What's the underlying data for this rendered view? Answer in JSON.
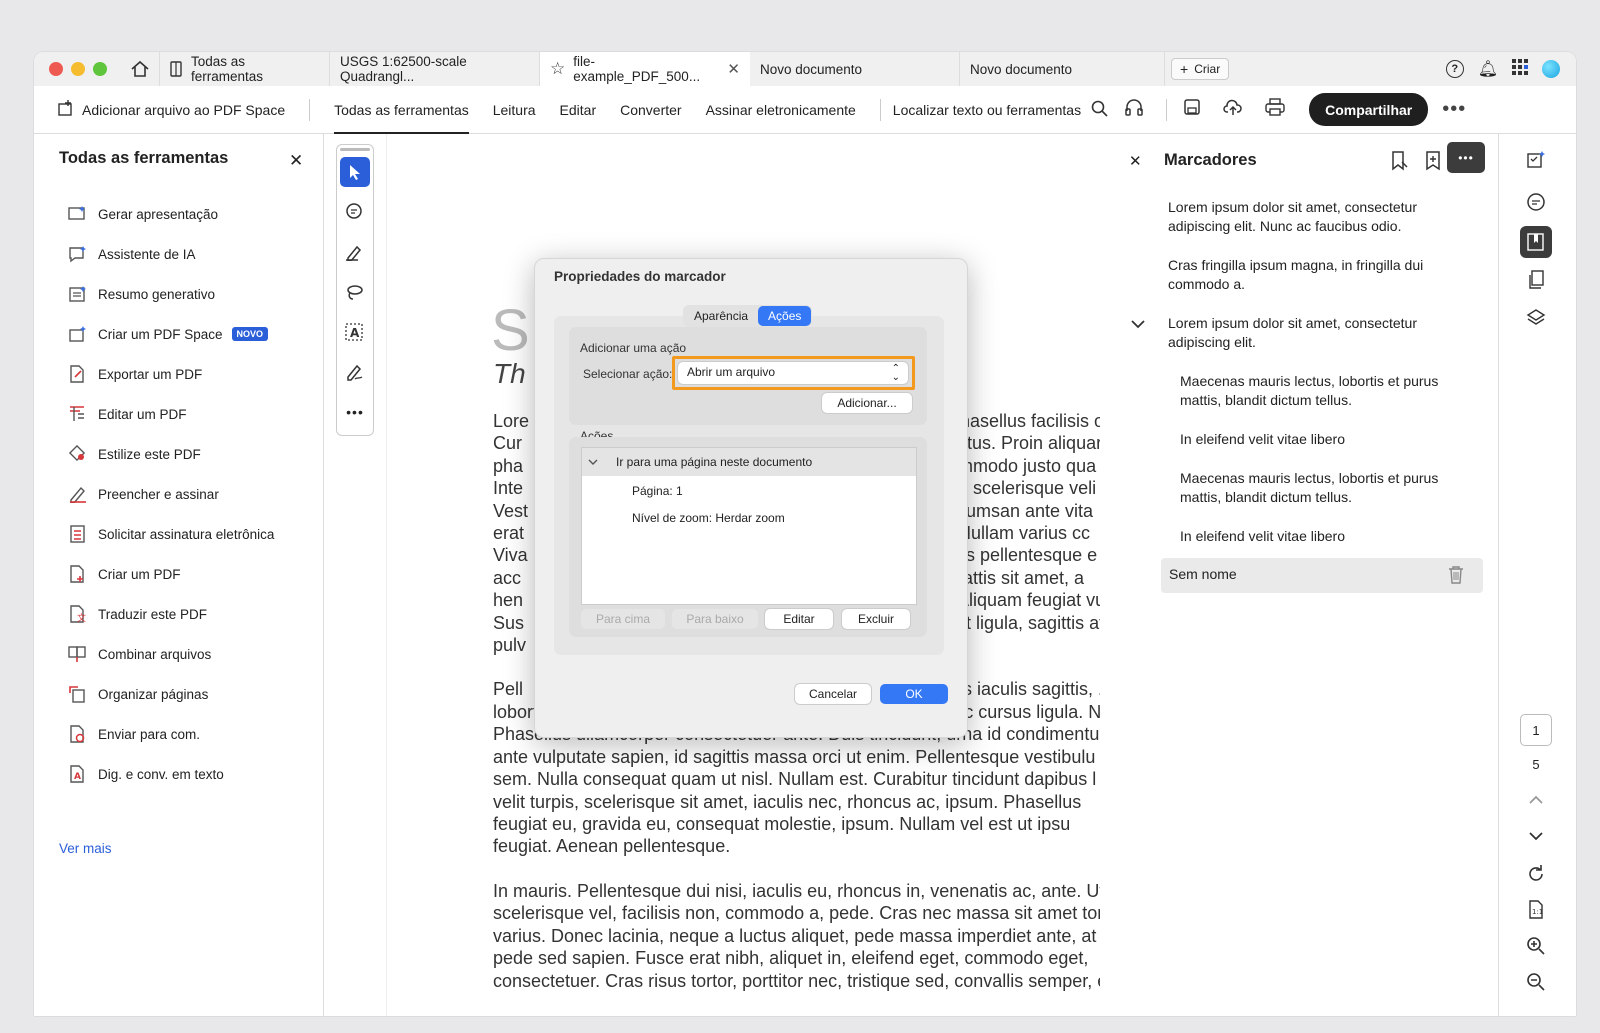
{
  "tabs": {
    "tools": "Todas as ferramentas",
    "usgs": "USGS 1:62500-scale Quadrangl...",
    "file": "file-example_PDF_500...",
    "novo1": "Novo documento",
    "novo2": "Novo documento",
    "criar": "Criar"
  },
  "toolbar": {
    "add_space": "Adicionar arquivo ao PDF Space",
    "all_tools": "Todas as ferramentas",
    "read": "Leitura",
    "edit": "Editar",
    "convert": "Converter",
    "sign": "Assinar eletronicamente",
    "find": "Localizar texto ou ferramentas",
    "share": "Compartilhar"
  },
  "left_panel": {
    "title": "Todas as ferramentas",
    "items": [
      "Gerar apresentação",
      "Assistente de IA",
      "Resumo generativo",
      "Criar um PDF Space",
      "Exportar um PDF",
      "Editar um PDF",
      "Estilize este PDF",
      "Preencher e assinar",
      "Solicitar assinatura eletrônica",
      "Criar um PDF",
      "Traduzir este PDF",
      "Combinar arquivos",
      "Organizar páginas",
      "Enviar para com.",
      "Dig. e conv. em texto"
    ],
    "badge": "NOVO",
    "see_more": "Ver mais"
  },
  "document": {
    "big_letter": "S",
    "subtitle": "Th",
    "p1_left": [
      "Lore",
      "Cur",
      "pha",
      "Inte",
      "Vest",
      "erat",
      "Viva",
      "acc",
      "hen",
      "Sus",
      "pulv"
    ],
    "p1_right": [
      "Phasellus facilisis o",
      "ectus. Proin aliquar",
      "ommodo justo qua",
      "an scelerisque veli",
      "ccumsan ante vita",
      ". Nullam varius cc",
      "llus pellentesque e",
      "mattis sit amet, a",
      ". Aliquam feugiat vu",
      "elit ligula, sagittis at",
      ""
    ],
    "p2_first_left": "Pell",
    "p2_first_right": "uis iaculis sagittis, .",
    "p2_rest": [
      "lobortis tortor, sed vestibulum dui metus venenatis est. Nunc cursus ligula. N",
      "Phasellus ullamcorper consectetuer ante. Duis tincidunt, urna id condimentum",
      "ante vulputate sapien, id sagittis massa orci ut enim. Pellentesque vestibulu",
      "sem. Nulla consequat quam ut nisl. Nullam est. Curabitur tincidunt dapibus l",
      "velit turpis, scelerisque sit amet, iaculis nec, rhoncus ac, ipsum. Phasellus",
      "feugiat eu, gravida eu, consequat molestie, ipsum. Nullam vel est ut ipsu",
      "feugiat. Aenean pellentesque."
    ],
    "p3": [
      "In mauris. Pellentesque dui nisi, iaculis eu, rhoncus in, venenatis ac, ante. Ut",
      "scelerisque vel, facilisis non, commodo a, pede. Cras nec massa sit amet tor",
      "varius. Donec lacinia, neque a luctus aliquet, pede massa imperdiet ante, at v",
      "pede sed sapien. Fusce erat nibh, aliquet in, eleifend eget, commodo eget,",
      "consectetuer. Cras risus tortor, porttitor nec, tristique sed, convallis semper, e"
    ]
  },
  "dialog": {
    "title": "Propriedades do marcador",
    "tab_appearance": "Aparência",
    "tab_actions": "Ações",
    "add_action": "Adicionar uma ação",
    "select_action_label": "Selecionar ação:",
    "select_action_value": "Abrir um arquivo",
    "add_button": "Adicionar...",
    "actions_label": "Ações",
    "action_item": "Ir para uma página neste documento",
    "page_detail": "Página: 1",
    "zoom_detail": "Nível de zoom: Herdar zoom",
    "btn_up": "Para cima",
    "btn_down": "Para baixo",
    "btn_edit": "Editar",
    "btn_delete": "Excluir",
    "cancel": "Cancelar",
    "ok": "OK"
  },
  "bookmarks": {
    "title": "Marcadores",
    "items": [
      [
        "Lorem ipsum dolor sit amet, consectetur",
        "adipiscing elit. Nunc ac faucibus odio."
      ],
      [
        "Cras fringilla ipsum magna, in fringilla dui",
        "commodo a."
      ],
      [
        "Lorem ipsum dolor sit amet, consectetur",
        "adipiscing elit."
      ],
      [
        "Maecenas mauris lectus, lobortis et purus",
        "mattis, blandit dictum tellus."
      ],
      [
        "In eleifend velit vitae libero",
        ""
      ],
      [
        "Maecenas mauris lectus, lobortis et purus",
        "mattis, blandit dictum tellus."
      ],
      [
        "In eleifend velit vitae libero",
        ""
      ]
    ],
    "selected": "Sem nome"
  },
  "rail": {
    "page_current": "1",
    "page_total": "5"
  },
  "colors": {
    "accent": "#2b5fd9",
    "dialog_blue": "#3478f6",
    "highlight": "#f39a1e"
  }
}
